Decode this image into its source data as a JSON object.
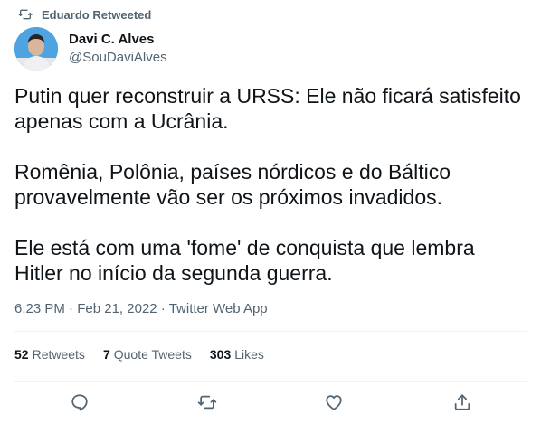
{
  "retweet_header": {
    "icon": "retweet-icon",
    "text": "Eduardo Retweeted"
  },
  "author": {
    "display_name": "Davi C. Alves",
    "handle": "@SouDaviAlves",
    "avatar_icon": "user-avatar",
    "avatar_bg": "#4fa3e0"
  },
  "tweet": {
    "paragraphs": [
      "Putin quer reconstruir a URSS: Ele não ficará satisfeito apenas com a Ucrânia.",
      "Romênia, Polônia, países nórdicos e do Báltico provavelmente vão ser os próximos invadidos.",
      "Ele está com uma 'fome' de conquista que lembra Hitler no início da segunda guerra."
    ],
    "time": "6:23 PM",
    "date": "Feb 21, 2022",
    "source": "Twitter Web App",
    "separator": "·"
  },
  "stats": {
    "retweets_count": "52",
    "retweets_label": "Retweets",
    "quotes_count": "7",
    "quotes_label": "Quote Tweets",
    "likes_count": "303",
    "likes_label": "Likes"
  },
  "actions": {
    "reply_icon": "reply-icon",
    "retweet_icon": "retweet-icon",
    "like_icon": "heart-icon",
    "share_icon": "share-icon",
    "icon_color": "#536471"
  }
}
